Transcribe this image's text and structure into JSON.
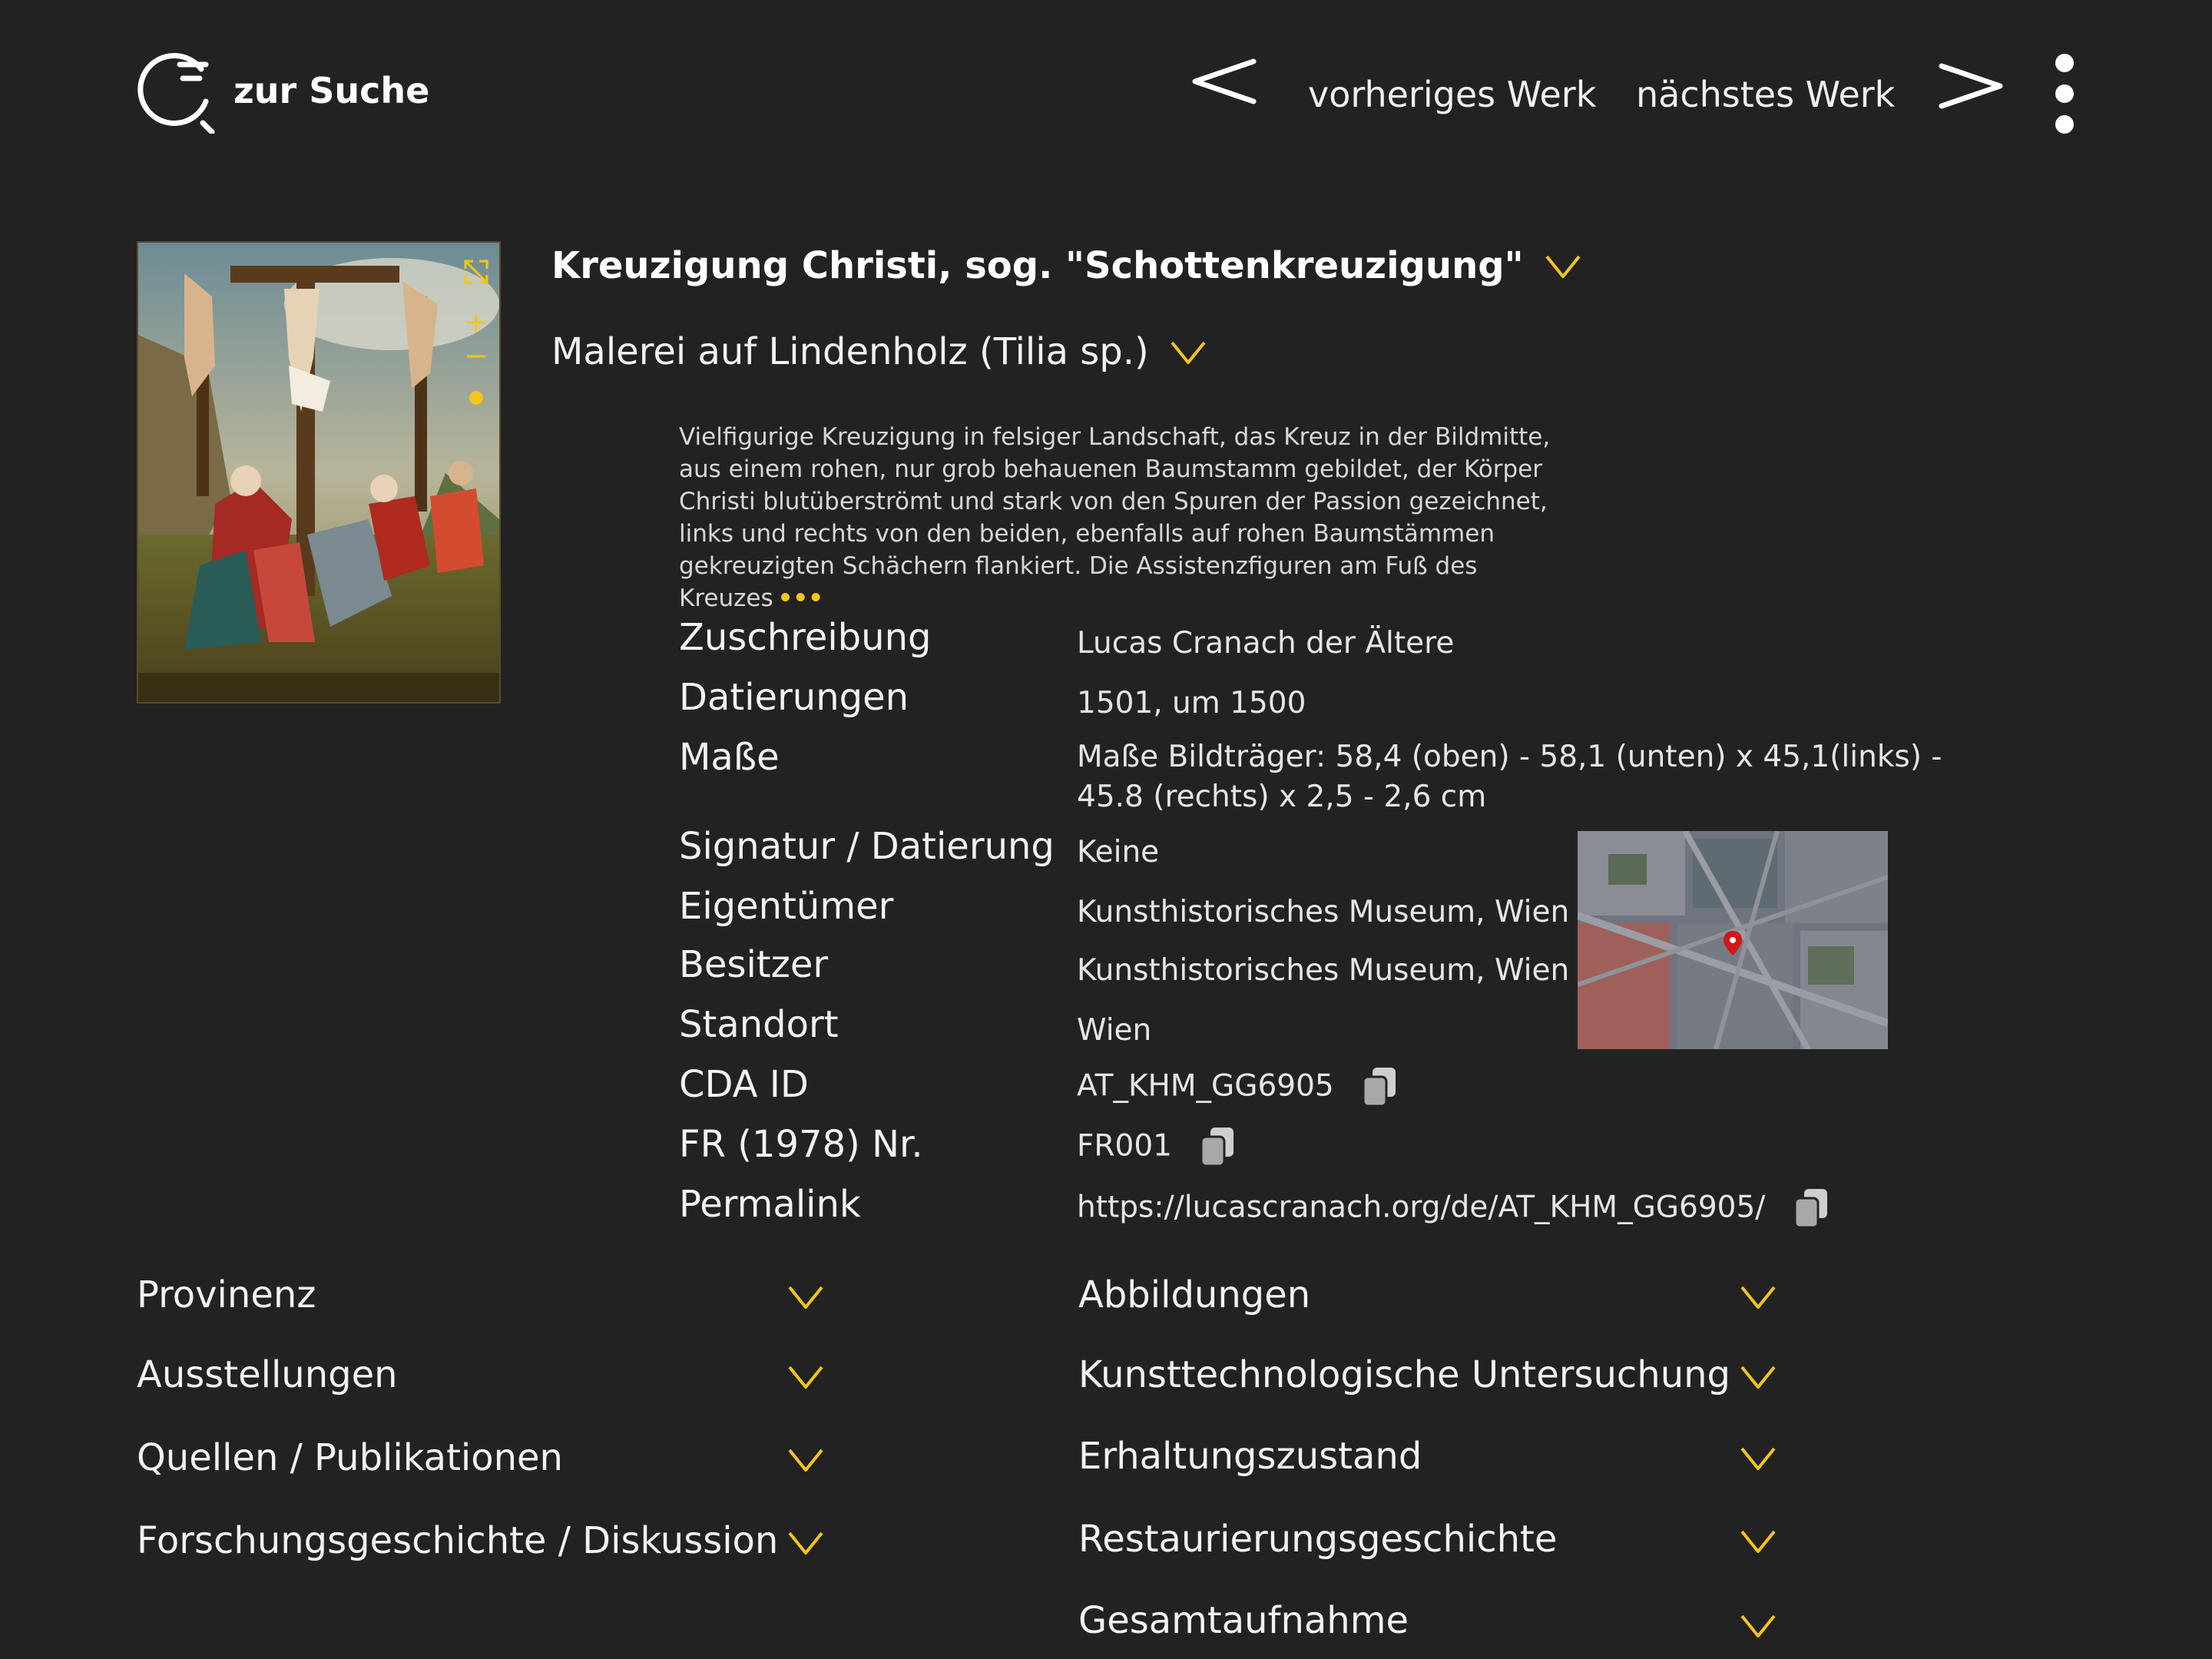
{
  "header": {
    "search_label": "zur Suche",
    "prev_label": "vorheriges Werk",
    "next_label": "nächstes Werk"
  },
  "work": {
    "title": "Kreuzigung Christi, sog. \"Schottenkreuzigung\"",
    "material": "Malerei auf Lindenholz (Tilia sp.)",
    "description": "Vielfigurige Kreuzigung in felsiger Landschaft, das Kreuz in der Bildmitte, aus einem rohen, nur grob behauenen Baumstamm gebildet, der Körper Christi blutüberströmt und stark von den Spuren der Passion gezeichnet, links und rechts von den beiden, ebenfalls auf rohen Baumstämmen gekreuzigten Schächern flankiert. Die Assistenzfiguren am Fuß des Kreuzes",
    "more_symbol": "•••"
  },
  "details": [
    {
      "label": "Zuschreibung",
      "value": "Lucas Cranach der Ältere"
    },
    {
      "label": "Datierungen",
      "value": "1501, um 1500"
    },
    {
      "label": "Maße",
      "value": "Maße Bildträger: 58,4 (oben) - 58,1 (unten) x 45,1(links) -",
      "value2": "45.8 (rechts) x 2,5 - 2,6 cm"
    },
    {
      "label": "Signatur / Datierung",
      "value": "Keine"
    },
    {
      "label": "Eigentümer",
      "value": "Kunsthistorisches Museum, Wien"
    },
    {
      "label": "Besitzer",
      "value": "Kunsthistorisches Museum, Wien"
    },
    {
      "label": "Standort",
      "value": "Wien"
    },
    {
      "label": "CDA ID",
      "value": "AT_KHM_GG6905"
    },
    {
      "label": "FR (1978) Nr.",
      "value": "FR001"
    },
    {
      "label": "Permalink",
      "value": "https://lucascranach.org/de/AT_KHM_GG6905/"
    }
  ],
  "sections_left": [
    "Provinenz",
    "Ausstellungen",
    "Quellen / Publikationen",
    "Forschungsgeschichte / Diskussion"
  ],
  "sections_right": [
    "Abbildungen",
    "Kunsttechnologische Untersuchung",
    "Erhaltungszustand",
    "Restaurierungsgeschichte",
    "Gesamtaufnahme"
  ],
  "colors": {
    "background": "#222222",
    "accent": "#f5c518",
    "text": "#f2f2f2"
  },
  "icons": {
    "search": "search-icon",
    "copy": "copy-icon",
    "chevron": "chevron-down-icon",
    "more": "kebab-menu-icon"
  }
}
